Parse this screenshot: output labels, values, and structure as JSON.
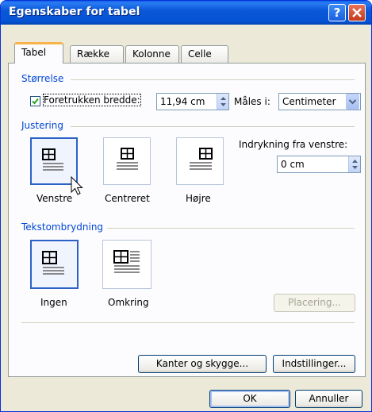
{
  "window": {
    "title": "Egenskaber for tabel"
  },
  "tabs": [
    {
      "label": "Tabel",
      "active": true
    },
    {
      "label": "Række",
      "active": false
    },
    {
      "label": "Kolonne",
      "active": false
    },
    {
      "label": "Celle",
      "active": false
    }
  ],
  "size": {
    "section_title": "Størrelse",
    "preferred_width_label": "Foretrukken bredde:",
    "preferred_width_checked": true,
    "preferred_width_value": "11,94 cm",
    "measure_label": "Måles i:",
    "measure_value": "Centimeter"
  },
  "alignment": {
    "section_title": "Justering",
    "options": [
      "Venstre",
      "Centreret",
      "Højre"
    ],
    "selected": "Venstre",
    "indent_label": "Indrykning fra venstre:",
    "indent_value": "0 cm"
  },
  "wrapping": {
    "section_title": "Tekstombrydning",
    "options": [
      "Ingen",
      "Omkring"
    ],
    "selected": "Ingen",
    "positioning_button": "Placering..."
  },
  "buttons": {
    "borders": "Kanter og skygge...",
    "options": "Indstillinger...",
    "ok": "OK",
    "cancel": "Annuller"
  },
  "colors": {
    "accent": "#0046d5",
    "titlebar": "#0a58d8",
    "selection": "#2c62c6"
  }
}
